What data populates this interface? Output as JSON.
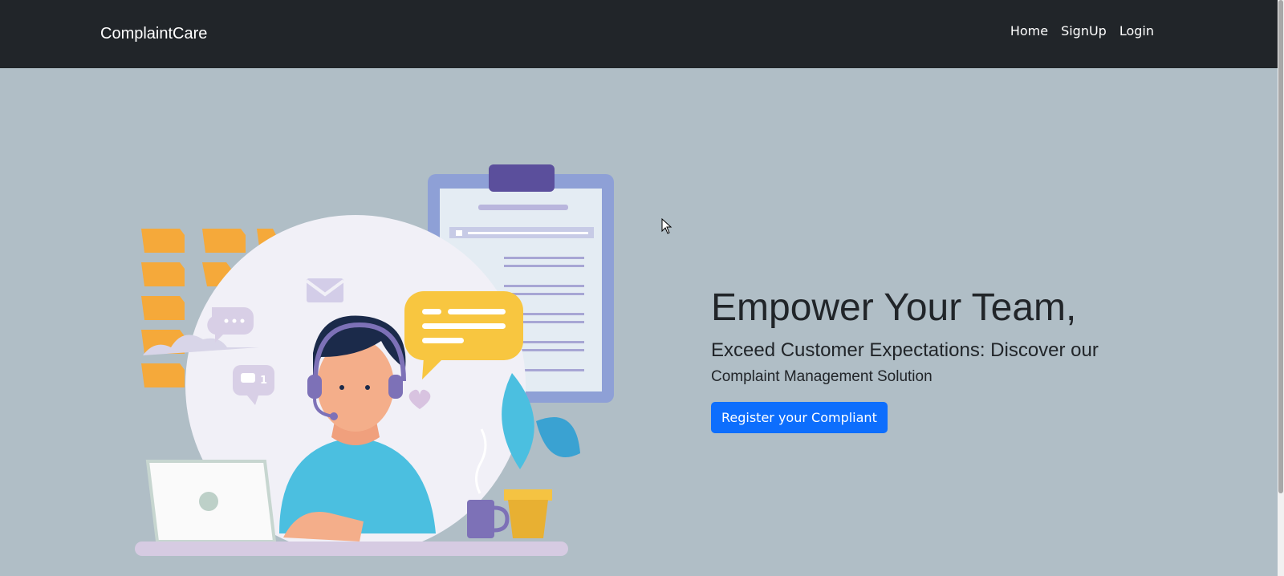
{
  "navbar": {
    "brand": "ComplaintCare",
    "links": [
      "Home",
      "SignUp",
      "Login"
    ]
  },
  "hero": {
    "headline": "Empower Your Team,",
    "subhead": "Exceed Customer Expectations: Discover our",
    "subhead2": "Complaint Management Solution",
    "cta_label": "Register your Compliant"
  },
  "illustration": {
    "chat_badge_count": "1"
  },
  "colors": {
    "navbar_bg": "#212529",
    "page_bg": "#b0bec6",
    "cta_bg": "#0d6efd",
    "folder_orange": "#f5a93a",
    "clipboard_blue": "#8ea0d6",
    "shirt_blue": "#4bbfe0"
  }
}
